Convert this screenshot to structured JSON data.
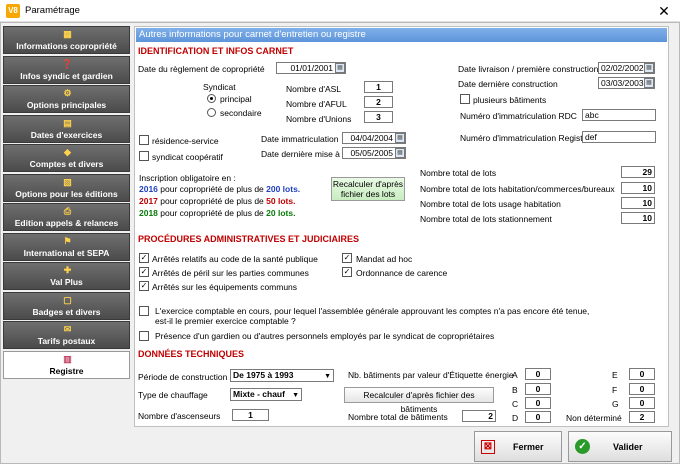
{
  "window": {
    "title": "Paramétrage",
    "app_icon": "V8"
  },
  "sidebar": {
    "items": [
      {
        "label": "Informations copropriété",
        "icon": "building-icon"
      },
      {
        "label": "Infos syndic et gardien",
        "icon": "info-icon"
      },
      {
        "label": "Options principales",
        "icon": "options-icon"
      },
      {
        "label": "Dates d'exercices",
        "icon": "calendar-icon"
      },
      {
        "label": "Comptes et divers",
        "icon": "accounts-icon"
      },
      {
        "label": "Options pour les éditions",
        "icon": "document-icon"
      },
      {
        "label": "Edition appels & relances",
        "icon": "print-icon"
      },
      {
        "label": "International et SEPA",
        "icon": "flag-icon"
      },
      {
        "label": "Val Plus",
        "icon": "valplus-icon"
      },
      {
        "label": "Badges et divers",
        "icon": "badge-icon"
      },
      {
        "label": "Tarifs postaux",
        "icon": "stamp-icon"
      },
      {
        "label": "Registre",
        "icon": "register-icon",
        "active": true
      }
    ]
  },
  "banner": "Autres informations pour carnet d'entretien ou registre",
  "identification": {
    "section_title": "IDENTIFICATION ET INFOS CARNET",
    "reglement_label": "Date du règlement de copropriété",
    "reglement_value": "01/01/2001",
    "syndicat_label": "Syndicat",
    "principal_label": "principal",
    "secondaire_label": "secondaire",
    "nb_asl_label": "Nombre d'ASL",
    "nb_asl_value": "1",
    "nb_aful_label": "Nombre d'AFUL",
    "nb_aful_value": "2",
    "nb_unions_label": "Nombre d'Unions",
    "nb_unions_value": "3",
    "livraison_label": "Date livraison / première construction",
    "livraison_value": "02/02/2002",
    "derniere_construction_label": "Date dernière construction",
    "derniere_construction_value": "03/03/2003",
    "plusieurs_batiments_label": "plusieurs bâtiments",
    "immat_rdc_label": "Numéro d'immatriculation RDC",
    "immat_rdc_value": "abc",
    "residence_service_label": "résidence-service",
    "syndicat_cooperatif_label": "syndicat coopératif",
    "date_immat_label": "Date immatriculation",
    "date_immat_value": "04/04/2004",
    "date_maj_label": "Date dernière mise à jour",
    "date_maj_value": "05/05/2005",
    "immat_registre_label": "Numéro d'immatriculation Registre",
    "immat_registre_value": "def",
    "inscription_label": "Inscription obligatoire en :",
    "year_2016": "2016",
    "text_2016_a": " pour copropriété de plus de ",
    "lots_2016": "200 lots",
    "year_2017": "2017",
    "text_2017_a": " pour copropriété de plus de ",
    "lots_2017": "50 lots",
    "year_2018": "2018",
    "text_2018_a": " pour copropriété de plus de ",
    "lots_2018": "20 lots",
    "dot": ".",
    "recalc_lots_button": "Recalculer d'après fichier des lots",
    "total_lots_label": "Nombre total de lots",
    "total_lots_value": "29",
    "total_habitation_label": "Nombre total de lots habitation/commerces/bureaux",
    "total_habitation_value": "10",
    "total_usage_label": "Nombre total de lots usage habitation",
    "total_usage_value": "10",
    "total_stationnement_label": "Nombre total de lots stationnement",
    "total_stationnement_value": "10"
  },
  "procedures": {
    "section_title": "PROCÉDURES ADMINISTRATIVES ET JUDICIAIRES",
    "sante_label": "Arrêtés relatifs au code de la santé publique",
    "peril_label": "Arrêtés de péril sur les parties communes",
    "equipements_label": "Arrêtés sur les équipements communs",
    "mandat_label": "Mandat ad hoc",
    "carence_label": "Ordonnance de carence",
    "exercice_label_1": "L'exercice comptable en cours, pour lequel l'assemblée générale approuvant les comptes n'a pas encore été tenue,",
    "exercice_label_2": "est-il le premier exercice comptable ?",
    "gardien_label": "Présence d'un gardien ou d'autres personnels employés par le syndicat de copropriétaires"
  },
  "techniques": {
    "section_title": "DONNÉES TECHNIQUES",
    "periode_label": "Période de construction",
    "periode_value": "De 1975 à 1993",
    "chauffage_label": "Type de chauffage",
    "chauffage_value": "Mixte - chauf",
    "ascenseurs_label": "Nombre d'ascenseurs",
    "ascenseurs_value": "1",
    "nb_energie_label": "Nb. bâtiments par valeur d'Étiquette énergie",
    "recalc_batiments_button": "Recalculer d'après fichier des bâtiments",
    "total_batiments_label": "Nombre total de bâtiments",
    "total_batiments_value": "2",
    "energy": {
      "A": "0",
      "B": "0",
      "C": "0",
      "D": "0",
      "E": "0",
      "F": "0",
      "G": "0",
      "nd": "2"
    },
    "label_A": "A",
    "label_B": "B",
    "label_C": "C",
    "label_D": "D",
    "label_E": "E",
    "label_F": "F",
    "label_G": "G",
    "label_nd": "Non déterminé"
  },
  "footer": {
    "close_label": "Fermer",
    "validate_label": "Valider"
  }
}
